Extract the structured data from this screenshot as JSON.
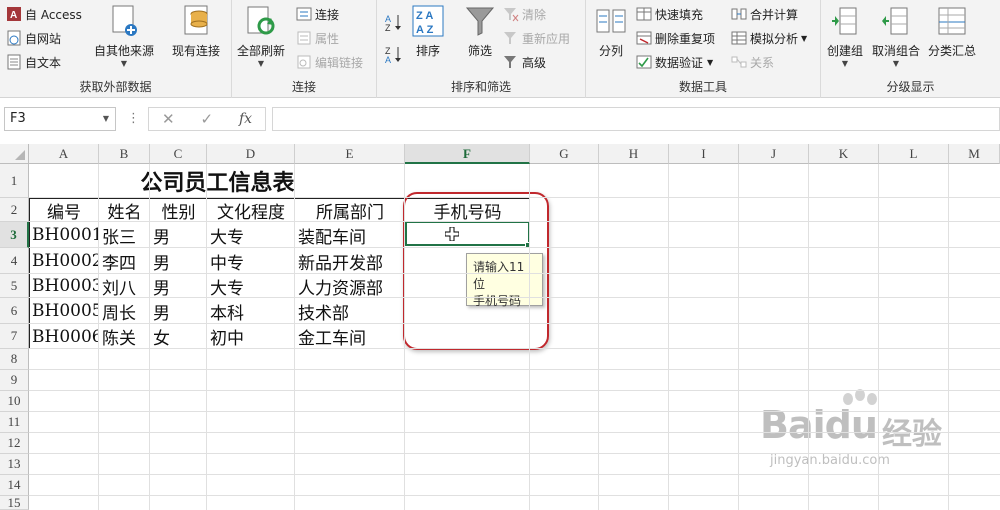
{
  "ribbon": {
    "external_data": {
      "label": "获取外部数据",
      "from_access": "自 Access",
      "from_web": "自网站",
      "from_text": "自文本",
      "from_other": "自其他来源",
      "existing_conn": "现有连接"
    },
    "connections": {
      "label": "连接",
      "refresh_all": "全部刷新",
      "connections": "连接",
      "properties": "属性",
      "edit_links": "编辑链接"
    },
    "sort_filter": {
      "label": "排序和筛选",
      "sort": "排序",
      "filter": "筛选",
      "clear": "清除",
      "reapply": "重新应用",
      "advanced": "高级"
    },
    "data_tools": {
      "label": "数据工具",
      "text_to_columns": "分列",
      "flash_fill": "快速填充",
      "remove_duplicates": "删除重复项",
      "data_validation": "数据验证",
      "consolidate": "合并计算",
      "what_if": "模拟分析",
      "relationships": "关系"
    },
    "outline": {
      "label": "分级显示",
      "group": "创建组",
      "ungroup": "取消组合",
      "subtotal": "分类汇总"
    }
  },
  "formula_bar": {
    "name_box": "F3",
    "fx_label": "fx",
    "value": ""
  },
  "columns": [
    "A",
    "B",
    "C",
    "D",
    "E",
    "F",
    "G",
    "H",
    "I",
    "J",
    "K",
    "L",
    "M"
  ],
  "rows": [
    "1",
    "2",
    "3",
    "4",
    "5",
    "6",
    "7",
    "8",
    "9",
    "10",
    "11",
    "12",
    "13",
    "14",
    "15"
  ],
  "sheet": {
    "title": "公司员工信息表",
    "headers": [
      "编号",
      "姓名",
      "性别",
      "文化程度",
      "所属部门",
      "手机号码"
    ],
    "records": [
      [
        "BH0001",
        "张三",
        "男",
        "大专",
        "装配车间"
      ],
      [
        "BH0002",
        "李四",
        "男",
        "中专",
        "新品开发部"
      ],
      [
        "BH0003",
        "刘八",
        "男",
        "大专",
        "人力资源部"
      ],
      [
        "BH0005",
        "周长",
        "男",
        "本科",
        "技术部"
      ],
      [
        "BH0006",
        "陈关",
        "女",
        "初中",
        "金工车间"
      ]
    ]
  },
  "tooltip": {
    "line1": "请输入11位",
    "line2": "手机号码"
  },
  "watermark": {
    "logo": "Baidu",
    "cn": "经验",
    "url": "jingyan.baidu.com"
  },
  "colors": {
    "excel_green": "#217346",
    "highlight_red": "#c0282d",
    "tooltip_bg": "#ffffe1"
  }
}
